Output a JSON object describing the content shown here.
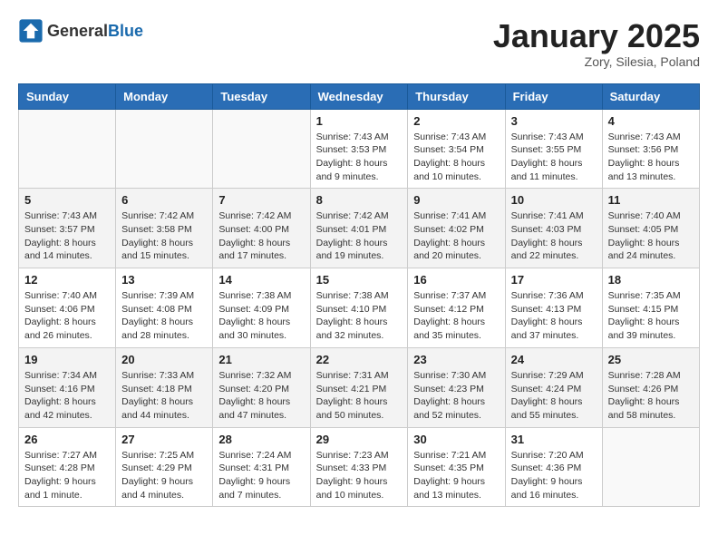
{
  "header": {
    "logo_general": "General",
    "logo_blue": "Blue",
    "month": "January 2025",
    "location": "Zory, Silesia, Poland"
  },
  "days_of_week": [
    "Sunday",
    "Monday",
    "Tuesday",
    "Wednesday",
    "Thursday",
    "Friday",
    "Saturday"
  ],
  "weeks": [
    [
      {
        "day": "",
        "info": ""
      },
      {
        "day": "",
        "info": ""
      },
      {
        "day": "",
        "info": ""
      },
      {
        "day": "1",
        "info": "Sunrise: 7:43 AM\nSunset: 3:53 PM\nDaylight: 8 hours\nand 9 minutes."
      },
      {
        "day": "2",
        "info": "Sunrise: 7:43 AM\nSunset: 3:54 PM\nDaylight: 8 hours\nand 10 minutes."
      },
      {
        "day": "3",
        "info": "Sunrise: 7:43 AM\nSunset: 3:55 PM\nDaylight: 8 hours\nand 11 minutes."
      },
      {
        "day": "4",
        "info": "Sunrise: 7:43 AM\nSunset: 3:56 PM\nDaylight: 8 hours\nand 13 minutes."
      }
    ],
    [
      {
        "day": "5",
        "info": "Sunrise: 7:43 AM\nSunset: 3:57 PM\nDaylight: 8 hours\nand 14 minutes."
      },
      {
        "day": "6",
        "info": "Sunrise: 7:42 AM\nSunset: 3:58 PM\nDaylight: 8 hours\nand 15 minutes."
      },
      {
        "day": "7",
        "info": "Sunrise: 7:42 AM\nSunset: 4:00 PM\nDaylight: 8 hours\nand 17 minutes."
      },
      {
        "day": "8",
        "info": "Sunrise: 7:42 AM\nSunset: 4:01 PM\nDaylight: 8 hours\nand 19 minutes."
      },
      {
        "day": "9",
        "info": "Sunrise: 7:41 AM\nSunset: 4:02 PM\nDaylight: 8 hours\nand 20 minutes."
      },
      {
        "day": "10",
        "info": "Sunrise: 7:41 AM\nSunset: 4:03 PM\nDaylight: 8 hours\nand 22 minutes."
      },
      {
        "day": "11",
        "info": "Sunrise: 7:40 AM\nSunset: 4:05 PM\nDaylight: 8 hours\nand 24 minutes."
      }
    ],
    [
      {
        "day": "12",
        "info": "Sunrise: 7:40 AM\nSunset: 4:06 PM\nDaylight: 8 hours\nand 26 minutes."
      },
      {
        "day": "13",
        "info": "Sunrise: 7:39 AM\nSunset: 4:08 PM\nDaylight: 8 hours\nand 28 minutes."
      },
      {
        "day": "14",
        "info": "Sunrise: 7:38 AM\nSunset: 4:09 PM\nDaylight: 8 hours\nand 30 minutes."
      },
      {
        "day": "15",
        "info": "Sunrise: 7:38 AM\nSunset: 4:10 PM\nDaylight: 8 hours\nand 32 minutes."
      },
      {
        "day": "16",
        "info": "Sunrise: 7:37 AM\nSunset: 4:12 PM\nDaylight: 8 hours\nand 35 minutes."
      },
      {
        "day": "17",
        "info": "Sunrise: 7:36 AM\nSunset: 4:13 PM\nDaylight: 8 hours\nand 37 minutes."
      },
      {
        "day": "18",
        "info": "Sunrise: 7:35 AM\nSunset: 4:15 PM\nDaylight: 8 hours\nand 39 minutes."
      }
    ],
    [
      {
        "day": "19",
        "info": "Sunrise: 7:34 AM\nSunset: 4:16 PM\nDaylight: 8 hours\nand 42 minutes."
      },
      {
        "day": "20",
        "info": "Sunrise: 7:33 AM\nSunset: 4:18 PM\nDaylight: 8 hours\nand 44 minutes."
      },
      {
        "day": "21",
        "info": "Sunrise: 7:32 AM\nSunset: 4:20 PM\nDaylight: 8 hours\nand 47 minutes."
      },
      {
        "day": "22",
        "info": "Sunrise: 7:31 AM\nSunset: 4:21 PM\nDaylight: 8 hours\nand 50 minutes."
      },
      {
        "day": "23",
        "info": "Sunrise: 7:30 AM\nSunset: 4:23 PM\nDaylight: 8 hours\nand 52 minutes."
      },
      {
        "day": "24",
        "info": "Sunrise: 7:29 AM\nSunset: 4:24 PM\nDaylight: 8 hours\nand 55 minutes."
      },
      {
        "day": "25",
        "info": "Sunrise: 7:28 AM\nSunset: 4:26 PM\nDaylight: 8 hours\nand 58 minutes."
      }
    ],
    [
      {
        "day": "26",
        "info": "Sunrise: 7:27 AM\nSunset: 4:28 PM\nDaylight: 9 hours\nand 1 minute."
      },
      {
        "day": "27",
        "info": "Sunrise: 7:25 AM\nSunset: 4:29 PM\nDaylight: 9 hours\nand 4 minutes."
      },
      {
        "day": "28",
        "info": "Sunrise: 7:24 AM\nSunset: 4:31 PM\nDaylight: 9 hours\nand 7 minutes."
      },
      {
        "day": "29",
        "info": "Sunrise: 7:23 AM\nSunset: 4:33 PM\nDaylight: 9 hours\nand 10 minutes."
      },
      {
        "day": "30",
        "info": "Sunrise: 7:21 AM\nSunset: 4:35 PM\nDaylight: 9 hours\nand 13 minutes."
      },
      {
        "day": "31",
        "info": "Sunrise: 7:20 AM\nSunset: 4:36 PM\nDaylight: 9 hours\nand 16 minutes."
      },
      {
        "day": "",
        "info": ""
      }
    ]
  ]
}
